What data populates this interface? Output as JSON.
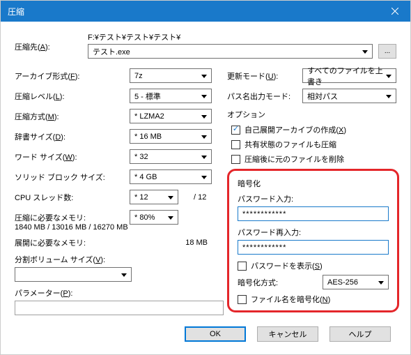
{
  "window": {
    "title": "圧縮"
  },
  "archive": {
    "label": "圧縮先(A):",
    "path_prefix": "F:¥テスト¥テスト¥テスト¥",
    "filename": "テスト.exe",
    "browse": "..."
  },
  "left": {
    "format_label": "アーカイブ形式(F):",
    "format_value": "7z",
    "level_label": "圧縮レベル(L):",
    "level_value": "5 - 標準",
    "method_label": "圧縮方式(M):",
    "method_value": "* LZMA2",
    "dict_label": "辞書サイズ(D):",
    "dict_value": "* 16 MB",
    "word_label": "ワード サイズ(W):",
    "word_value": "* 32",
    "solid_label": "ソリッド ブロック サイズ:",
    "solid_value": "* 4 GB",
    "threads_label": "CPU スレッド数:",
    "threads_value": "* 12",
    "threads_total": "/ 12",
    "mem_comp_label": "圧縮に必要なメモリ:",
    "mem_comp_value": "* 80%",
    "mem_comp_detail": "1840 MB / 13016 MB / 16270 MB",
    "mem_decomp_label": "展開に必要なメモリ:",
    "mem_decomp_value": "18 MB",
    "split_label": "分割ボリューム サイズ(V):",
    "param_label": "パラメーター(P):"
  },
  "right": {
    "update_label": "更新モード(U):",
    "update_value": "すべてのファイルを上書き",
    "pathmode_label": "パス名出力モード:",
    "pathmode_value": "相対パス",
    "options_title": "オプション",
    "opt_sfx": "自己展開アーカイブの作成(X)",
    "opt_shared": "共有状態のファイルも圧縮",
    "opt_delete": "圧縮後に元のファイルを削除"
  },
  "enc": {
    "title": "暗号化",
    "pw_label": "パスワード入力:",
    "pw_value": "************",
    "pw2_label": "パスワード再入力:",
    "pw2_value": "************",
    "show_pw": "パスワードを表示(S)",
    "method_label": "暗号化方式:",
    "method_value": "AES-256",
    "enc_names": "ファイル名を暗号化(N)"
  },
  "footer": {
    "ok": "OK",
    "cancel": "キャンセル",
    "help": "ヘルプ"
  }
}
